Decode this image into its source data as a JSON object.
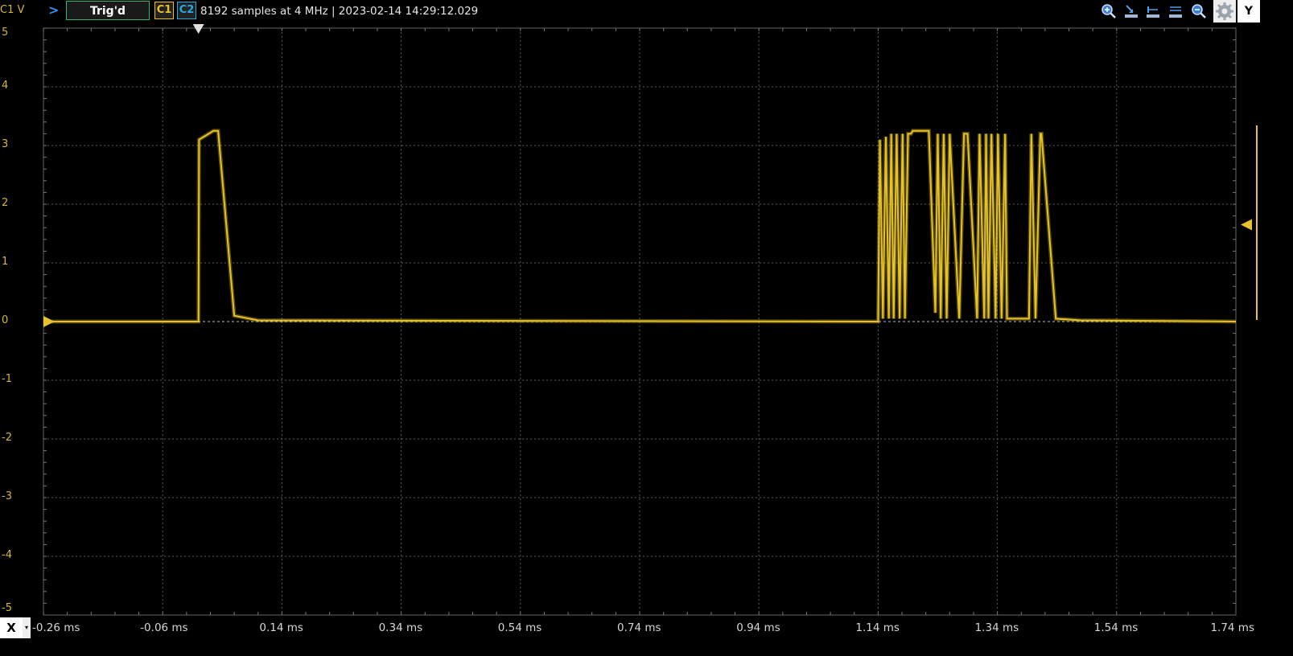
{
  "toolbar": {
    "channel_unit": "C1 V",
    "trigger_status": "Trig'd",
    "channel1": "C1",
    "channel2": "C2",
    "acquisition_info": "8192 samples at 4 MHz | 2023-02-14 14:29:12.029",
    "y_button": "Y"
  },
  "bottom": {
    "x_button": "X",
    "x_dropdown": "▾"
  },
  "axes": {
    "y_ticks": [
      "5",
      "4",
      "3",
      "2",
      "1",
      "0",
      "-1",
      "-2",
      "-3",
      "-4",
      "-5"
    ],
    "x_ticks": [
      "-0.26 ms",
      "-0.06 ms",
      "0.14 ms",
      "0.34 ms",
      "0.54 ms",
      "0.74 ms",
      "0.94 ms",
      "1.14 ms",
      "1.34 ms",
      "1.54 ms",
      "1.74 ms"
    ]
  },
  "colors": {
    "trace": "#e6c229",
    "grid": "#5a5a5a",
    "trig": "#2bb673",
    "c1": "#e8c12e",
    "c2": "#29a8e0"
  },
  "chart_data": {
    "type": "line",
    "title": "",
    "xlabel": "",
    "ylabel": "C1 V",
    "xlim": [
      -0.26,
      1.74
    ],
    "ylim": [
      -5,
      5
    ],
    "grid": true,
    "series": [
      {
        "values_x_ms": [
          -0.26,
          0.0,
          0.001,
          0.025,
          0.033,
          0.06,
          0.1,
          1.14,
          1.143,
          1.148,
          1.153,
          1.158,
          1.162,
          1.166,
          1.171,
          1.176,
          1.181,
          1.185,
          1.19,
          1.195,
          1.198,
          1.2,
          1.225,
          1.236,
          1.24,
          1.245,
          1.25,
          1.255,
          1.26,
          1.276,
          1.284,
          1.29,
          1.306,
          1.31,
          1.318,
          1.321,
          1.325,
          1.33,
          1.337,
          1.341,
          1.347,
          1.353,
          1.356,
          1.393,
          1.397,
          1.404,
          1.412,
          1.414,
          1.438,
          1.48,
          1.74
        ],
        "values_y_v": [
          0,
          0,
          3.1,
          3.25,
          3.25,
          0.1,
          0.02,
          0,
          3.1,
          0.05,
          3.15,
          0.05,
          3.2,
          0.05,
          3.2,
          0.05,
          3.2,
          0.05,
          3.2,
          3.2,
          3.25,
          3.25,
          3.25,
          0.15,
          3.2,
          0.05,
          3.2,
          0.05,
          3.2,
          0.05,
          3.2,
          3.2,
          0.05,
          3.2,
          0.05,
          3.2,
          0.05,
          3.2,
          0.05,
          3.2,
          0.05,
          3.2,
          0.05,
          0.05,
          3.2,
          0.05,
          3.2,
          3.2,
          0.05,
          0.02,
          0
        ]
      }
    ]
  }
}
